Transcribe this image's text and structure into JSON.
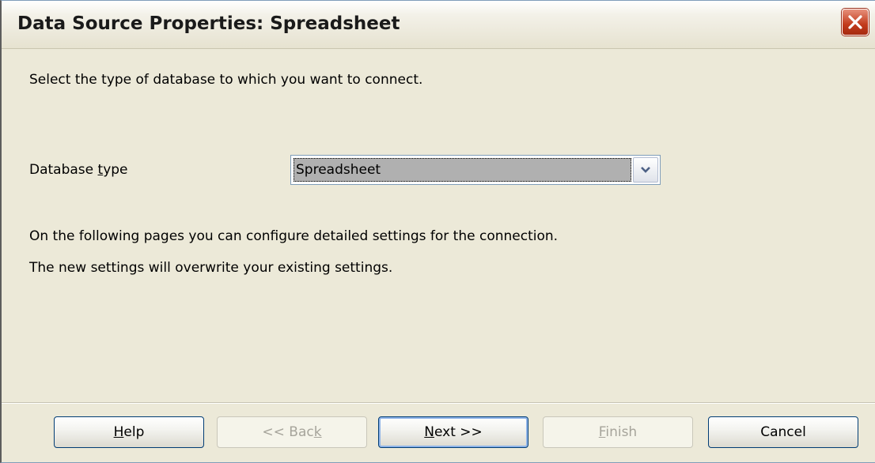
{
  "window": {
    "title": "Data Source Properties: Spreadsheet"
  },
  "content": {
    "intro": "Select the type of database to which you want to connect.",
    "db_type_label_prefix": "Database ",
    "db_type_label_mnemonic": "t",
    "db_type_label_suffix": "ype",
    "db_type_value": "Spreadsheet",
    "info_line_1": "On the following pages you can configure detailed settings for the connection.",
    "info_line_2": "The new settings will overwrite your existing settings."
  },
  "buttons": {
    "help": {
      "mnemonic": "H",
      "rest": "elp",
      "enabled": true
    },
    "back": {
      "prefix": "<< Bac",
      "mnemonic": "k",
      "enabled": false
    },
    "next": {
      "mnemonic": "N",
      "rest": "ext >>",
      "enabled": true
    },
    "finish": {
      "mnemonic": "F",
      "rest": "inish",
      "enabled": false
    },
    "cancel": {
      "label": "Cancel",
      "enabled": true
    }
  },
  "icons": {
    "close": "close-icon",
    "dropdown": "chevron-down-icon"
  },
  "colors": {
    "window_bg": "#ece9d8",
    "close_red": "#c23b1c",
    "select_highlight": "#b0b0b0"
  }
}
